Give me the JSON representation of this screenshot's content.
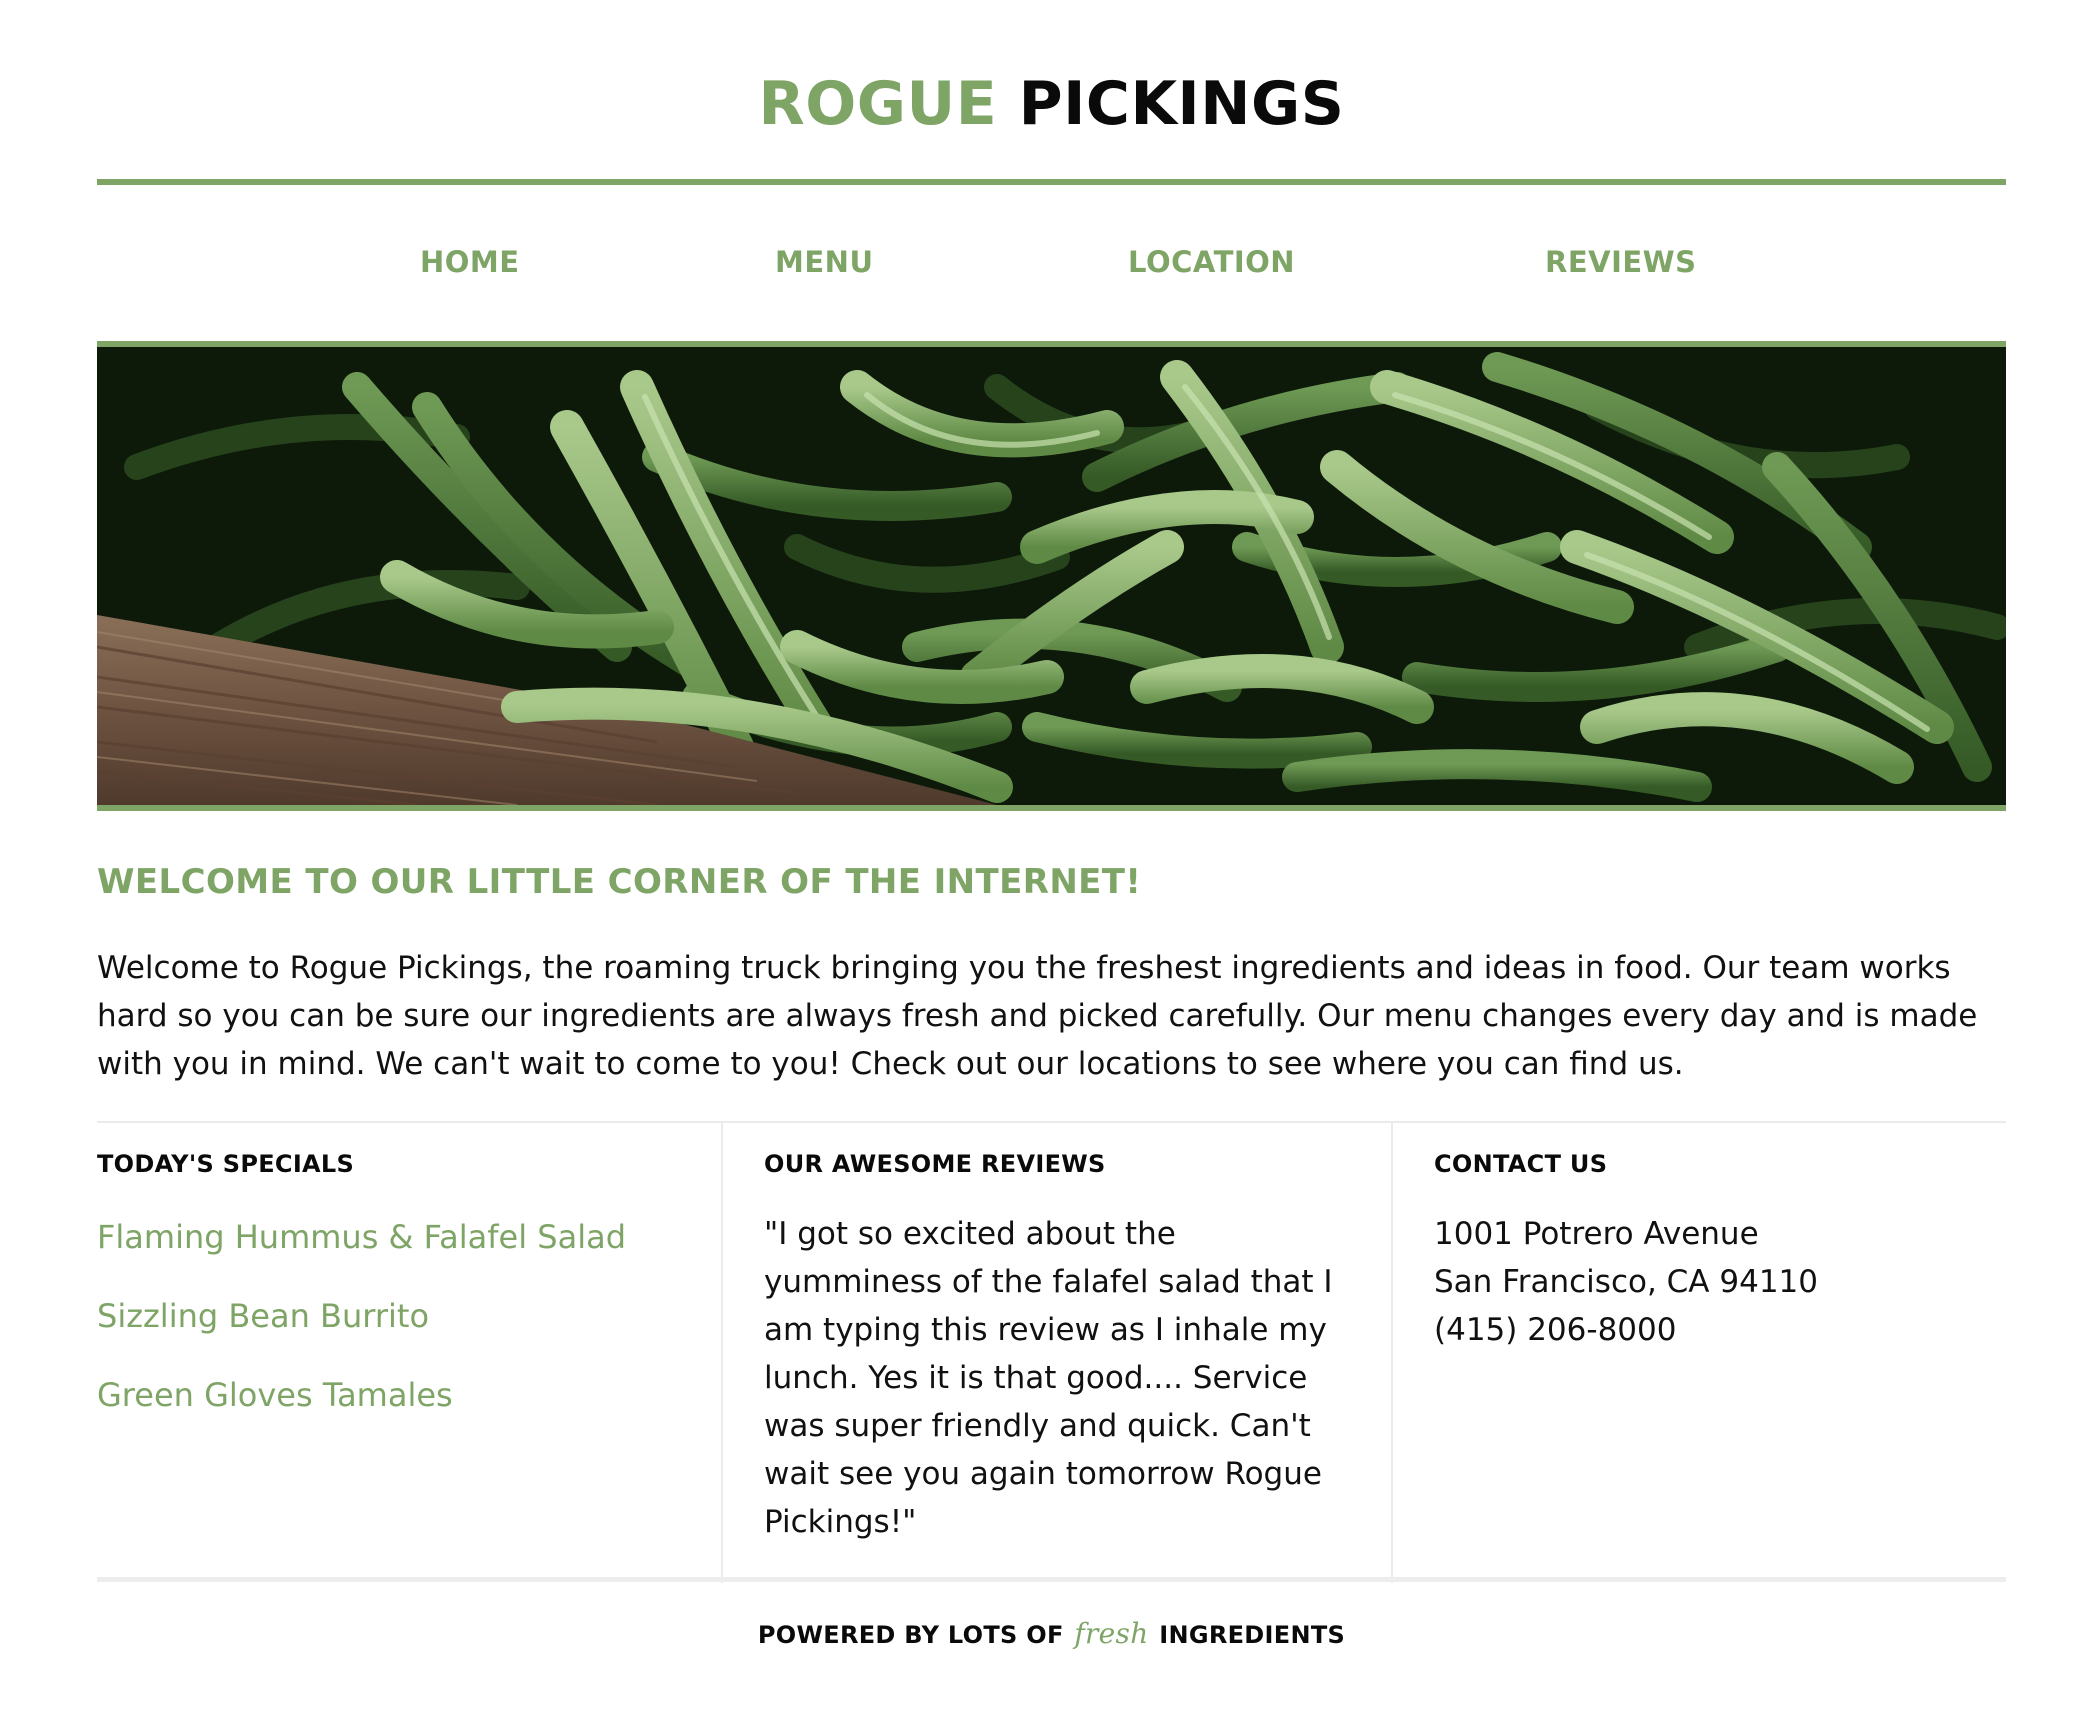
{
  "header": {
    "title_accent": "ROGUE",
    "title_main": "PICKINGS"
  },
  "nav": {
    "items": [
      {
        "label": "HOME"
      },
      {
        "label": "MENU"
      },
      {
        "label": "LOCATION"
      },
      {
        "label": "REVIEWS"
      }
    ]
  },
  "hero": {
    "icon": "green-beans-photo"
  },
  "welcome": {
    "title": "WELCOME TO OUR LITTLE CORNER OF THE INTERNET!",
    "text": "Welcome to Rogue Pickings, the roaming truck bringing you the freshest ingredients and ideas in food. Our team works hard so you can be sure our ingredients are always fresh and picked carefully. Our menu changes every day and is made with you in mind. We can't wait to come to you! Check out our locations to see where you can find us."
  },
  "specials": {
    "heading": "TODAY'S SPECIALS",
    "items": [
      {
        "label": "Flaming Hummus & Falafel Salad"
      },
      {
        "label": "Sizzling Bean Burrito"
      },
      {
        "label": "Green Gloves Tamales"
      }
    ]
  },
  "reviews": {
    "heading": "OUR AWESOME REVIEWS",
    "text": "\"I got so excited about the yumminess of the falafel salad that I am typing this review as I inhale my lunch. Yes it is that good.... Service was super friendly and quick. Can't wait see you again tomorrow Rogue Pickings!\""
  },
  "contact": {
    "heading": "CONTACT US",
    "address_line1": "1001 Potrero Avenue",
    "address_line2": "San Francisco, CA 94110",
    "phone": "(415) 206-8000"
  },
  "footer": {
    "prefix": "POWERED BY LOTS OF",
    "emphasis": "fresh",
    "suffix": "INGREDIENTS"
  },
  "colors": {
    "accent": "#7ea466",
    "text": "#111111",
    "divider": "#ebebeb"
  }
}
